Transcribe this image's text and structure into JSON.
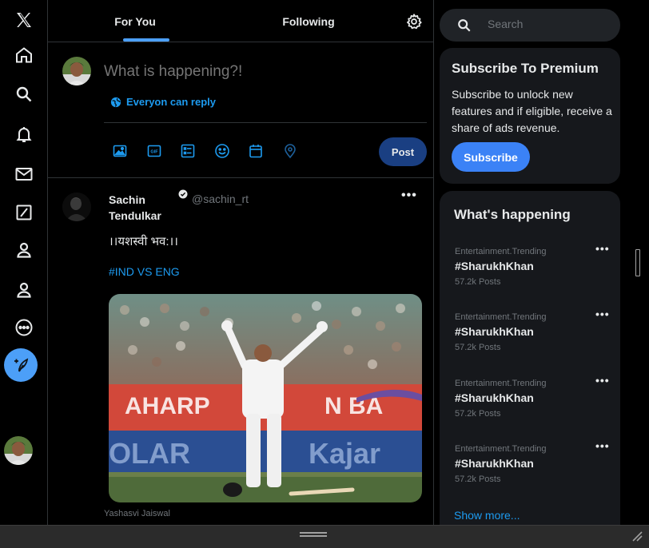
{
  "nav": {
    "items": [
      "x-logo",
      "home",
      "explore",
      "notifications",
      "messages",
      "grok",
      "profile",
      "communities",
      "more"
    ],
    "compose_icon": "feather-plus-icon",
    "accent": "#4c9ff8"
  },
  "header": {
    "tabs": [
      {
        "label": "For You",
        "active": true
      },
      {
        "label": "Following",
        "active": false
      }
    ]
  },
  "composer": {
    "placeholder": "What is happening?!",
    "reply_setting": "Everyon can reply",
    "post_label": "Post",
    "tools": [
      "image-icon",
      "gif-icon",
      "poll-icon",
      "emoji-icon",
      "schedule-icon",
      "location-icon"
    ]
  },
  "tweet": {
    "name": "Sachin Tendulkar",
    "handle": "@sachin_rt",
    "text": "।।यशस्वी भव:।।",
    "hashtag": "#IND VS ENG",
    "image_caption": "Yashasvi Jaiswal",
    "more": "•••"
  },
  "search": {
    "placeholder": "Search"
  },
  "premium": {
    "title": "Subscribe To Premium",
    "body": "Subscribe to unlock new features and if eligible, receive a share of ads revenue.",
    "button": "Subscribe"
  },
  "happening": {
    "title": "What's happening",
    "trends": [
      {
        "category": "Entertainment.Trending",
        "name": "#SharukhKhan",
        "posts": "57.2k Posts"
      },
      {
        "category": "Entertainment.Trending",
        "name": "#SharukhKhan",
        "posts": "57.2k Posts"
      },
      {
        "category": "Entertainment.Trending",
        "name": "#SharukhKhan",
        "posts": "57.2k Posts"
      },
      {
        "category": "Entertainment.Trending",
        "name": "#SharukhKhan",
        "posts": "57.2k Posts"
      }
    ],
    "show_more": "Show more..."
  },
  "colors": {
    "background": "#000000",
    "panel": "#16181c",
    "link": "#1d9bf0",
    "subscribe": "#3b82f6",
    "post_button": "#1a3f82"
  }
}
